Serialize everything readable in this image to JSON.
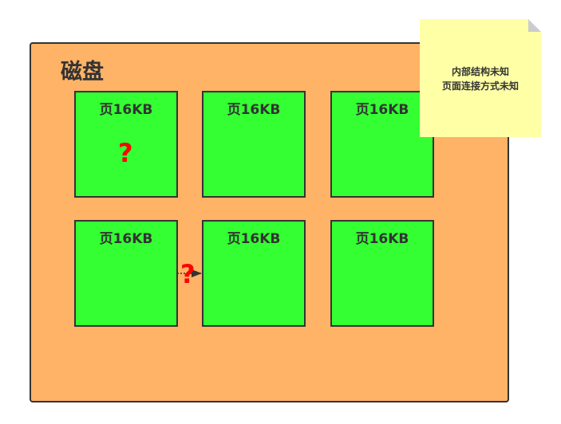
{
  "disk": {
    "title": "磁盘"
  },
  "pages": [
    {
      "label": "页16KB"
    },
    {
      "label": "页16KB"
    },
    {
      "label": "页16KB"
    },
    {
      "label": "页16KB"
    },
    {
      "label": "页16KB"
    },
    {
      "label": "页16KB"
    }
  ],
  "unknown_marks": {
    "page_mark": "?",
    "link_mark": "?"
  },
  "note": {
    "line1": "内部结构未知",
    "line2": "页面连接方式未知"
  },
  "colors": {
    "disk_fill": "#ffb366",
    "page_fill": "#33ff33",
    "note_fill": "#ffffa6",
    "question_mark": "#ff0000",
    "stroke": "#333333"
  }
}
